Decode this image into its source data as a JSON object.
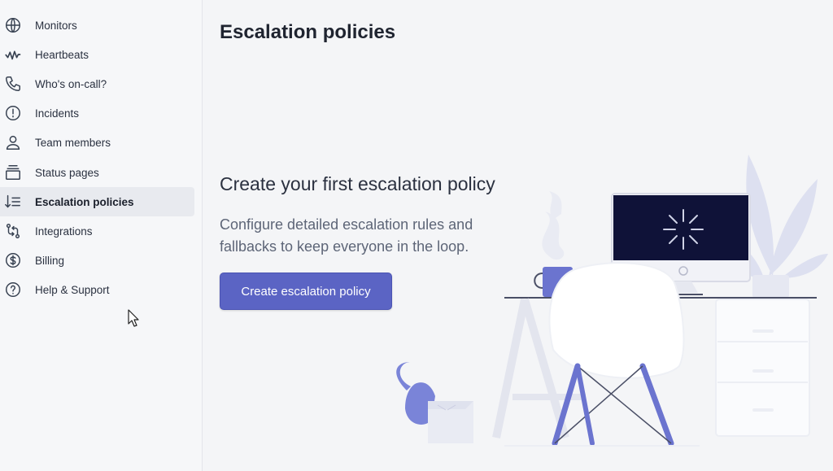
{
  "sidebar": {
    "items": [
      {
        "label": "Monitors",
        "icon": "globe-icon"
      },
      {
        "label": "Heartbeats",
        "icon": "heartbeat-icon"
      },
      {
        "label": "Who's on-call?",
        "icon": "phone-icon"
      },
      {
        "label": "Incidents",
        "icon": "alert-circle-icon"
      },
      {
        "label": "Team members",
        "icon": "user-icon"
      },
      {
        "label": "Status pages",
        "icon": "status-pages-icon"
      },
      {
        "label": "Escalation policies",
        "icon": "escalation-icon",
        "active": true
      },
      {
        "label": "Integrations",
        "icon": "integrations-icon"
      },
      {
        "label": "Billing",
        "icon": "dollar-icon"
      },
      {
        "label": "Help & Support",
        "icon": "help-icon"
      }
    ]
  },
  "main": {
    "title": "Escalation policies",
    "empty_state": {
      "heading": "Create your first escalation policy",
      "description": "Configure detailed escalation rules and fallbacks to keep everyone in the loop.",
      "button_label": "Create escalation policy"
    }
  },
  "colors": {
    "accent": "#5b64c4",
    "active_nav_bg": "#e8eaef",
    "illustration_purple": "#6b74cf",
    "monitor_screen": "#0f1238"
  }
}
